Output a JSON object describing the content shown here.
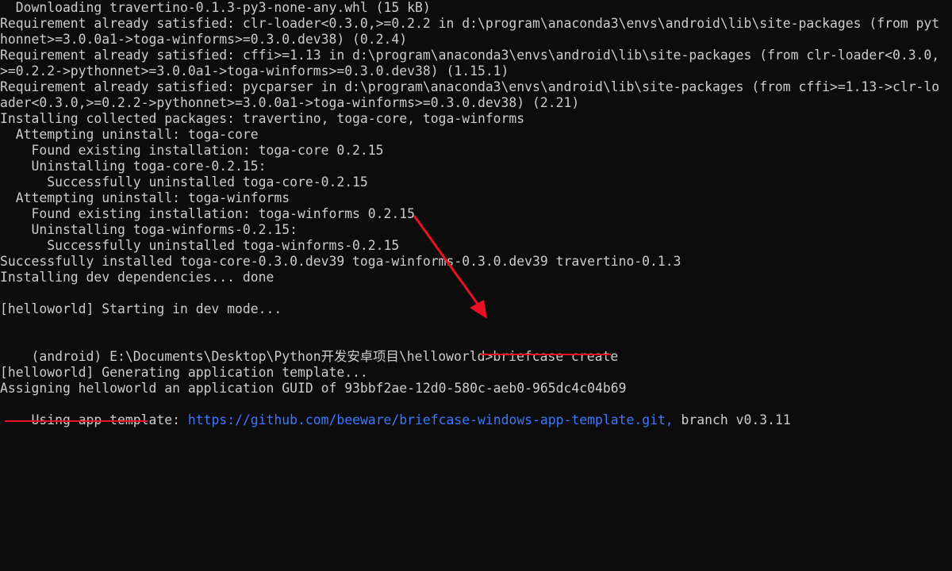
{
  "terminal": {
    "lines": [
      "  Downloading travertino-0.1.3-py3-none-any.whl (15 kB)",
      "Requirement already satisfied: clr-loader<0.3.0,>=0.2.2 in d:\\program\\anaconda3\\envs\\android\\lib\\site-packages (from pyt",
      "honnet>=3.0.0a1->toga-winforms>=0.3.0.dev38) (0.2.4)",
      "Requirement already satisfied: cffi>=1.13 in d:\\program\\anaconda3\\envs\\android\\lib\\site-packages (from clr-loader<0.3.0,",
      ">=0.2.2->pythonnet>=3.0.0a1->toga-winforms>=0.3.0.dev38) (1.15.1)",
      "Requirement already satisfied: pycparser in d:\\program\\anaconda3\\envs\\android\\lib\\site-packages (from cffi>=1.13->clr-lo",
      "ader<0.3.0,>=0.2.2->pythonnet>=3.0.0a1->toga-winforms>=0.3.0.dev38) (2.21)",
      "Installing collected packages: travertino, toga-core, toga-winforms",
      "  Attempting uninstall: toga-core",
      "    Found existing installation: toga-core 0.2.15",
      "    Uninstalling toga-core-0.2.15:",
      "      Successfully uninstalled toga-core-0.2.15",
      "  Attempting uninstall: toga-winforms",
      "    Found existing installation: toga-winforms 0.2.15",
      "    Uninstalling toga-winforms-0.2.15:",
      "      Successfully uninstalled toga-winforms-0.2.15",
      "Successfully installed toga-core-0.3.0.dev39 toga-winforms-0.3.0.dev39 travertino-0.1.3",
      "Installing dev dependencies... done",
      "",
      "[helloworld] Starting in dev mode...",
      ""
    ],
    "prompt": "(android) E:\\Documents\\Desktop\\Python开发安卓项目\\helloworld>",
    "command": "briefcase create",
    "after_lines": [
      "",
      "[helloworld] Generating application template...",
      "Assigning helloworld an application GUID of 93bbf2ae-12d0-580c-aeb0-965dc4c04b69"
    ],
    "template_prefix": "Using app template: ",
    "template_url": "https://github.com/beeware/briefcase-windows-app-template.git,",
    "template_suffix": " branch v0.3.11"
  },
  "colors": {
    "background": "#0c0c0c",
    "text": "#cccccc",
    "link": "#3b78ff",
    "annotation": "#e81123"
  }
}
